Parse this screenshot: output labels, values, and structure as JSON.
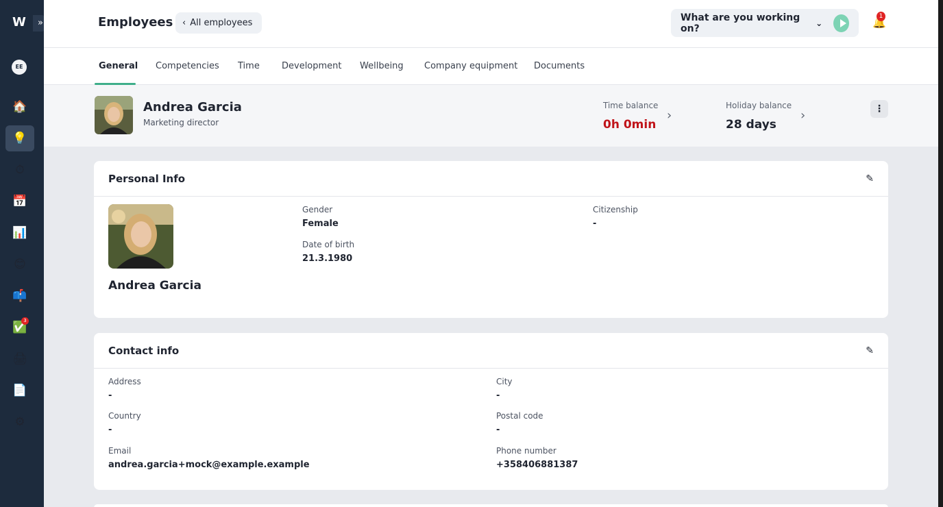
{
  "sidebar": {
    "logo": "W",
    "expand_icon": "»",
    "user_initials": "EE",
    "items": [
      {
        "icon": "home-icon",
        "glyph": "🏠"
      },
      {
        "icon": "employees-icon",
        "glyph": "💡"
      },
      {
        "icon": "timer-icon",
        "glyph": "⏱"
      },
      {
        "icon": "calendar-icon",
        "glyph": "📅"
      },
      {
        "icon": "reports-icon",
        "glyph": "📊"
      },
      {
        "icon": "wellbeing-icon",
        "glyph": "😊"
      },
      {
        "icon": "mailbox-icon",
        "glyph": "📫"
      },
      {
        "icon": "tasks-icon",
        "glyph": "✅",
        "badge": "3"
      },
      {
        "icon": "printer-icon",
        "glyph": "🖨"
      },
      {
        "icon": "document-icon",
        "glyph": "📄"
      },
      {
        "icon": "settings-icon",
        "glyph": "⚙"
      }
    ]
  },
  "header": {
    "title": "Employees",
    "back_label": "All employees",
    "back_icon": "‹",
    "working_prompt": "What are you working on?",
    "chevron": "⌄",
    "notification_count": "1",
    "bell_glyph": "🔔"
  },
  "tabs": [
    "General",
    "Competencies",
    "Time",
    "Development",
    "Wellbeing",
    "Company equipment",
    "Documents"
  ],
  "active_tab": "General",
  "profile": {
    "name": "Andrea Garcia",
    "role": "Marketing director",
    "time_balance_label": "Time balance",
    "time_balance_value": "0h 0min",
    "holiday_balance_label": "Holiday balance",
    "holiday_balance_value": "28 days",
    "arrow": "›",
    "more": "⋮"
  },
  "personal_info": {
    "title": "Personal Info",
    "name": "Andrea Garcia",
    "gender_label": "Gender",
    "gender_value": "Female",
    "dob_label": "Date of birth",
    "dob_value": "21.3.1980",
    "citizenship_label": "Citizenship",
    "citizenship_value": "-"
  },
  "contact_info": {
    "title": "Contact info",
    "address_label": "Address",
    "address_value": "-",
    "city_label": "City",
    "city_value": "-",
    "country_label": "Country",
    "country_value": "-",
    "postal_label": "Postal code",
    "postal_value": "-",
    "email_label": "Email",
    "email_value": "andrea.garcia+mock@example.example",
    "phone_label": "Phone number",
    "phone_value": "+358406881387"
  },
  "edit_glyph": "✎",
  "colors": {
    "sidebar": "#1d2b3d",
    "accent": "#3fae8a",
    "time_balance": "#c0141a",
    "play": "#7dd3b4"
  }
}
